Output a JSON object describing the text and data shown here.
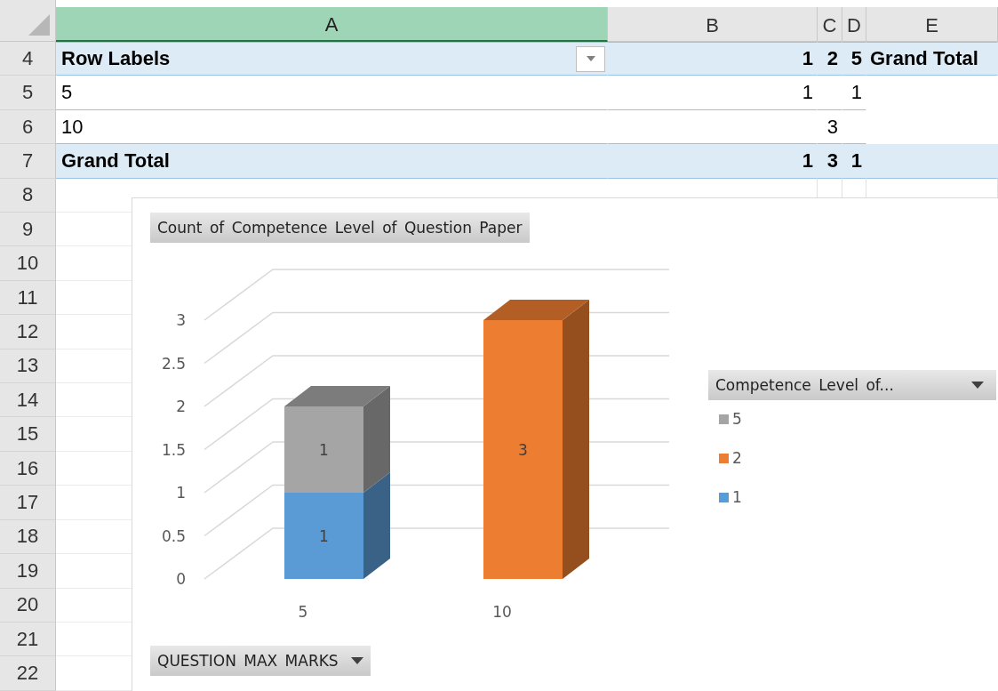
{
  "columns": [
    {
      "label": "A",
      "selected": true
    },
    {
      "label": "B",
      "selected": false
    },
    {
      "label": "C",
      "selected": false
    },
    {
      "label": "D",
      "selected": false
    },
    {
      "label": "E",
      "selected": false
    }
  ],
  "rows": [
    {
      "number": "4",
      "kind": "header",
      "filter": true,
      "cells": [
        "Row Labels",
        "1",
        "2",
        "5",
        "Grand Total"
      ]
    },
    {
      "number": "5",
      "kind": "data",
      "cells": [
        "5",
        "1",
        null,
        "1"
      ]
    },
    {
      "number": "6",
      "kind": "data",
      "cells": [
        "10",
        null,
        "3"
      ]
    },
    {
      "number": "7",
      "kind": "total",
      "cells": [
        "Grand Total",
        "1",
        "3",
        "1"
      ]
    },
    {
      "number": "8",
      "kind": "empty"
    },
    {
      "number": "9",
      "kind": "empty"
    },
    {
      "number": "10",
      "kind": "empty"
    },
    {
      "number": "11",
      "kind": "empty"
    },
    {
      "number": "12",
      "kind": "empty"
    },
    {
      "number": "13",
      "kind": "empty"
    },
    {
      "number": "14",
      "kind": "empty"
    },
    {
      "number": "15",
      "kind": "empty"
    },
    {
      "number": "16",
      "kind": "empty"
    },
    {
      "number": "17",
      "kind": "empty"
    },
    {
      "number": "18",
      "kind": "empty"
    },
    {
      "number": "19",
      "kind": "empty"
    },
    {
      "number": "20",
      "kind": "empty"
    },
    {
      "number": "21",
      "kind": "empty"
    },
    {
      "number": "22",
      "kind": "empty"
    }
  ],
  "chart": {
    "value_field_button": "Count of Competence Level of Question Paper",
    "axis_field_button": "QUESTION MAX MARKS",
    "legend_field_button": "Competence Level of...",
    "chart_data": {
      "type": "bar",
      "stacked": true,
      "categories": [
        "5",
        "10"
      ],
      "series": [
        {
          "name": "1",
          "color": "#5b9bd5",
          "values": [
            1,
            null
          ]
        },
        {
          "name": "2",
          "color": "#ed7d31",
          "values": [
            null,
            3
          ]
        },
        {
          "name": "5",
          "color": "#a5a5a5",
          "values": [
            1,
            null
          ]
        }
      ],
      "ylim": [
        0,
        3
      ],
      "yticks": [
        0,
        0.5,
        1,
        1.5,
        2,
        2.5,
        3
      ],
      "data_labels": true
    }
  }
}
